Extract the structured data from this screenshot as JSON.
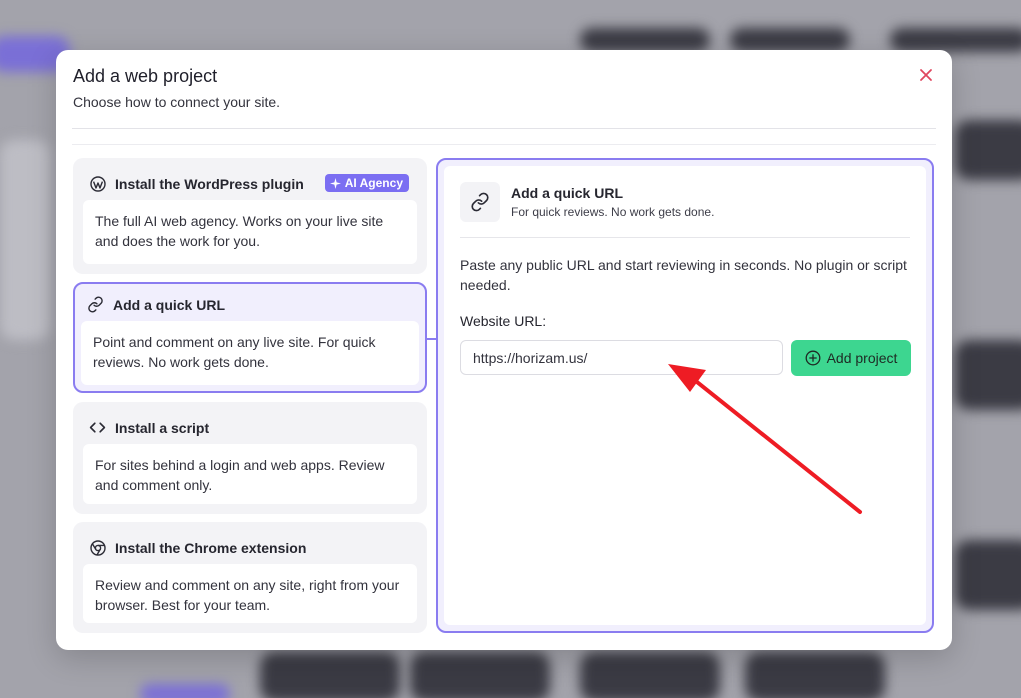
{
  "modal": {
    "title": "Add a web project",
    "subtitle": "Choose how to connect your site."
  },
  "options": [
    {
      "title": "Install the WordPress plugin",
      "description": "The full AI web agency. Works on your live site and does the work for you.",
      "badge": "AI Agency",
      "icon": "wordpress-icon"
    },
    {
      "title": "Add a quick URL",
      "description": "Point and comment on any live site. For quick reviews. No work gets done.",
      "icon": "link-icon",
      "selected": true
    },
    {
      "title": "Install a script",
      "description": "For sites behind a login and web apps. Review and comment only.",
      "icon": "code-icon"
    },
    {
      "title": "Install the Chrome extension",
      "description": "Review and comment on any site, right from your browser. Best for your team.",
      "icon": "chrome-icon"
    }
  ],
  "panel": {
    "title": "Add a quick URL",
    "subtitle": "For quick reviews. No work gets done.",
    "description": "Paste any public URL and start reviewing in seconds. No plugin or script needed.",
    "url_label": "Website URL:",
    "url_value": "https://horizam.us/",
    "add_button": "Add project",
    "icon": "link-icon"
  },
  "colors": {
    "accent": "#8a7cf0",
    "badge": "#7b6ef2",
    "button": "#3dd690",
    "close": "#e0475f",
    "arrow": "#ee1c24"
  }
}
